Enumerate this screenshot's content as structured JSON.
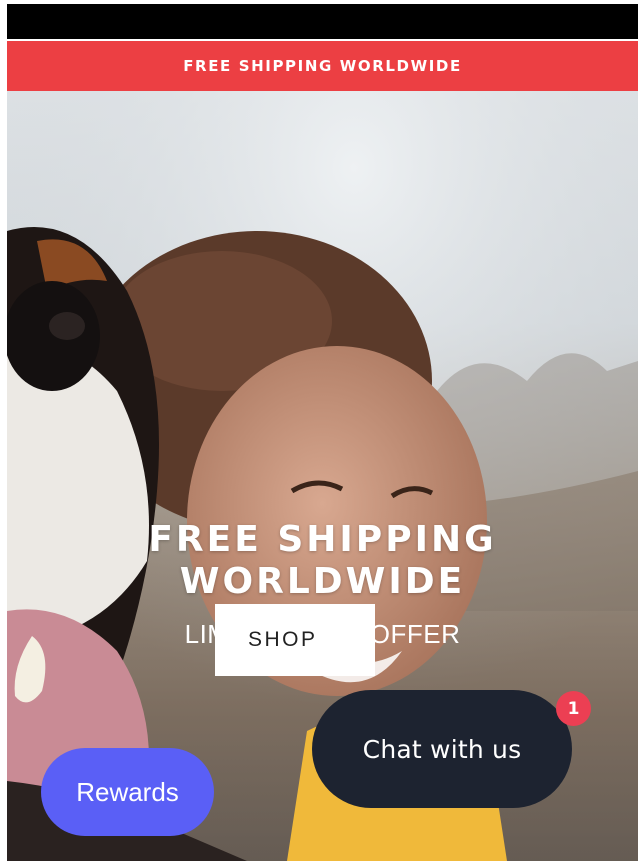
{
  "announcement": {
    "text": "FREE SHIPPING WORLDWIDE",
    "background": "#ec3f43"
  },
  "hero": {
    "title_line1": "FREE SHIPPING",
    "title_line2": "WORLDWIDE",
    "subtitle": "LIMITED TIME OFFER",
    "image": "dog-and-woman-photo",
    "button_label": "SHOP"
  },
  "chat": {
    "label": "Chat with us",
    "badge_count": "1",
    "background": "#1d2330",
    "badge_color": "#ec3f53"
  },
  "rewards": {
    "label": "Rewards",
    "background": "#5a5ff6"
  }
}
